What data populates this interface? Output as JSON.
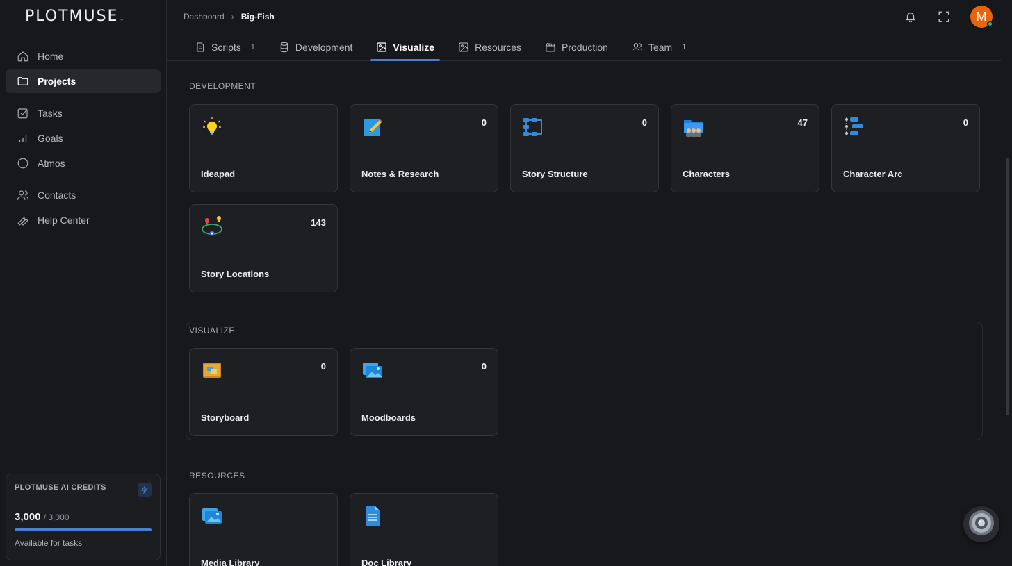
{
  "app": {
    "logo": "PLOTMUSE",
    "logo_tm": "™"
  },
  "sidebar": {
    "items": [
      {
        "label": "Home",
        "icon": "home-icon"
      },
      {
        "label": "Projects",
        "icon": "folder-icon",
        "active": true
      },
      {
        "label": "Tasks",
        "icon": "check-square-icon"
      },
      {
        "label": "Goals",
        "icon": "bar-chart-icon"
      },
      {
        "label": "Atmos",
        "icon": "circle-icon"
      },
      {
        "label": "Contacts",
        "icon": "users-icon"
      },
      {
        "label": "Help Center",
        "icon": "wrench-icon"
      }
    ],
    "credits": {
      "title": "PLOTMUSE AI CREDITS",
      "amount": "3,000",
      "total": "/ 3,000",
      "fraction_remaining": 1.0,
      "note": "Available for tasks"
    }
  },
  "breadcrumb": {
    "root": "Dashboard",
    "separator": "›",
    "current": "Big-Fish"
  },
  "tabs": [
    {
      "label": "Scripts",
      "count": "1",
      "icon": "script-icon"
    },
    {
      "label": "Development",
      "count": "",
      "icon": "database-icon"
    },
    {
      "label": "Visualize",
      "count": "",
      "icon": "image-icon",
      "active": true
    },
    {
      "label": "Resources",
      "count": "",
      "icon": "picture-icon"
    },
    {
      "label": "Production",
      "count": "",
      "icon": "clapper-icon"
    },
    {
      "label": "Team",
      "count": "1",
      "icon": "team-icon"
    }
  ],
  "sections": {
    "development": {
      "title": "DEVELOPMENT",
      "cards": [
        {
          "label": "Ideapad",
          "count": "",
          "icon": "lightbulb-icon"
        },
        {
          "label": "Notes & Research",
          "count": "0",
          "icon": "notepad-icon"
        },
        {
          "label": "Story Structure",
          "count": "0",
          "icon": "flowchart-icon"
        },
        {
          "label": "Characters",
          "count": "47",
          "icon": "characters-folder-icon"
        },
        {
          "label": "Character Arc",
          "count": "0",
          "icon": "arc-list-icon"
        },
        {
          "label": "Story Locations",
          "count": "143",
          "icon": "map-pins-icon"
        }
      ]
    },
    "visualize": {
      "title": "VISUALIZE",
      "cards": [
        {
          "label": "Storyboard",
          "count": "0",
          "icon": "storyboard-icon"
        },
        {
          "label": "Moodboards",
          "count": "0",
          "icon": "moodboard-icon"
        }
      ]
    },
    "resources": {
      "title": "RESOURCES",
      "cards": [
        {
          "label": "Media Library",
          "count": "",
          "icon": "media-library-icon"
        },
        {
          "label": "Doc Library",
          "count": "",
          "icon": "document-icon"
        }
      ]
    }
  },
  "user": {
    "initial": "M",
    "avatar_color": "#e8650e"
  },
  "colors": {
    "accent": "#4a7fd0",
    "background": "#17181b",
    "card": "#1e1f23"
  }
}
